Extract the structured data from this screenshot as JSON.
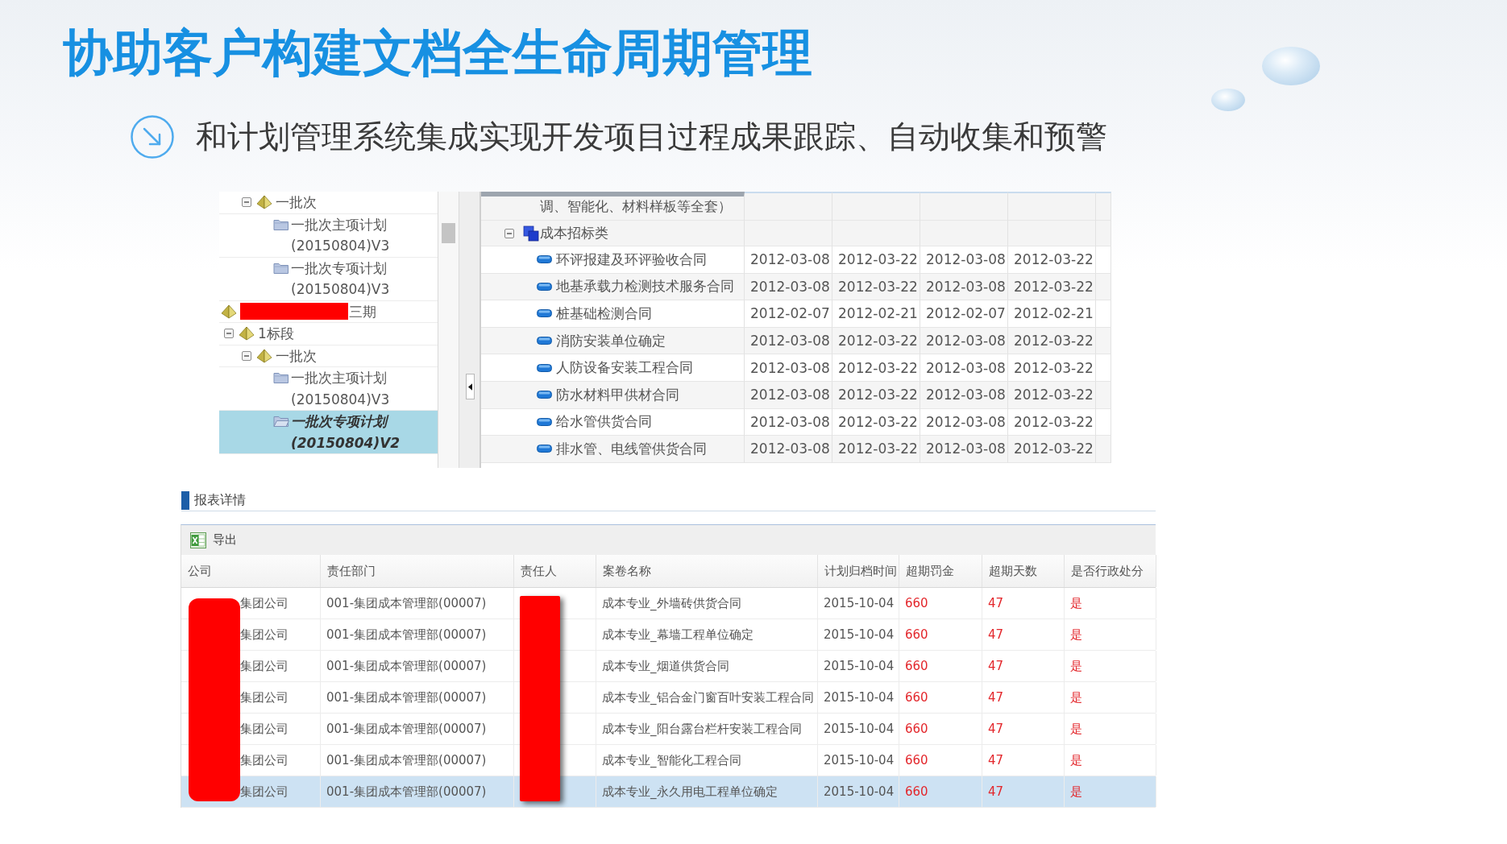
{
  "title": "协助客户构建文档全生命周期管理",
  "subtitle": "和计划管理系统集成实现开发项目过程成果跟踪、自动收集和预警",
  "plan_screen": {
    "tree": [
      {
        "kind": "batch",
        "label": "一批次",
        "expanded": true,
        "selected": false,
        "children": [
          {
            "kind": "plan",
            "label": "一批次主项计划(20150804)V3",
            "selected": false
          },
          {
            "kind": "plan",
            "label": "一批次专项计划(20150804)V3",
            "selected": false
          }
        ]
      },
      {
        "kind": "project",
        "label": "三期",
        "redacted": true,
        "selected": false,
        "children": [
          {
            "kind": "section",
            "label": "1标段",
            "expanded": true,
            "selected": false,
            "children": [
              {
                "kind": "batch",
                "label": "一批次",
                "expanded": true,
                "selected": false,
                "children": [
                  {
                    "kind": "plan",
                    "label": "一批次主项计划(20150804)V3",
                    "selected": false
                  },
                  {
                    "kind": "plan",
                    "label": "一批次专项计划(20150804)V2",
                    "selected": true
                  }
                ]
              }
            ]
          }
        ]
      }
    ],
    "grid": {
      "cut_off_row": {
        "label": "调、智能化、材料样板等全套）"
      },
      "group": {
        "label": "成本招标类",
        "expanded": true
      },
      "rows": [
        {
          "name": "环评报建及环评验收合同",
          "dates": [
            "2012-03-08",
            "2012-03-22",
            "2012-03-08",
            "2012-03-22"
          ]
        },
        {
          "name": "地基承载力检测技术服务合同",
          "dates": [
            "2012-03-08",
            "2012-03-22",
            "2012-03-08",
            "2012-03-22"
          ]
        },
        {
          "name": "桩基础检测合同",
          "dates": [
            "2012-02-07",
            "2012-02-21",
            "2012-02-07",
            "2012-02-21"
          ]
        },
        {
          "name": "消防安装单位确定",
          "dates": [
            "2012-03-08",
            "2012-03-22",
            "2012-03-08",
            "2012-03-22"
          ]
        },
        {
          "name": "人防设备安装工程合同",
          "dates": [
            "2012-03-08",
            "2012-03-22",
            "2012-03-08",
            "2012-03-22"
          ]
        },
        {
          "name": "防水材料甲供材合同",
          "dates": [
            "2012-03-08",
            "2012-03-22",
            "2012-03-08",
            "2012-03-22"
          ]
        },
        {
          "name": "给水管供货合同",
          "dates": [
            "2012-03-08",
            "2012-03-22",
            "2012-03-08",
            "2012-03-22"
          ]
        },
        {
          "name": "排水管、电线管供货合同",
          "dates": [
            "2012-03-08",
            "2012-03-22",
            "2012-03-08",
            "2012-03-22"
          ]
        }
      ]
    }
  },
  "report": {
    "heading": "报表详情",
    "export_button": "导出",
    "columns": [
      {
        "label": "公司",
        "kind": "text",
        "redacted": true
      },
      {
        "label": "责任部门",
        "kind": "text",
        "redacted": false
      },
      {
        "label": "责任人",
        "redacted": true
      },
      {
        "label": "案卷名称",
        "kind": "text",
        "redacted": false
      },
      {
        "label": "计划归档时间",
        "kind": "text",
        "redacted": false
      },
      {
        "label": "超期罚金",
        "kind": "alert",
        "redacted": false
      },
      {
        "label": "超期天数",
        "kind": "alert",
        "redacted": false
      },
      {
        "label": "是否行政处分",
        "kind": "alert",
        "redacted": false
      }
    ],
    "rows": [
      {
        "company": "集团公司",
        "department": "001-集团成本管理部(00007)",
        "file_name": "成本专业_外墙砖供货合同",
        "archive_date": "2015-10-04",
        "fine": "660",
        "overdue_days": "47",
        "administrative_penalty": "是",
        "selected": false
      },
      {
        "company": "集团公司",
        "department": "001-集团成本管理部(00007)",
        "file_name": "成本专业_幕墙工程单位确定",
        "archive_date": "2015-10-04",
        "fine": "660",
        "overdue_days": "47",
        "administrative_penalty": "是",
        "selected": false
      },
      {
        "company": "集团公司",
        "department": "001-集团成本管理部(00007)",
        "file_name": "成本专业_烟道供货合同",
        "archive_date": "2015-10-04",
        "fine": "660",
        "overdue_days": "47",
        "administrative_penalty": "是",
        "selected": false
      },
      {
        "company": "集团公司",
        "department": "001-集团成本管理部(00007)",
        "file_name": "成本专业_铝合金门窗百叶安装工程合同",
        "archive_date": "2015-10-04",
        "fine": "660",
        "overdue_days": "47",
        "administrative_penalty": "是",
        "selected": false
      },
      {
        "company": "集团公司",
        "department": "001-集团成本管理部(00007)",
        "file_name": "成本专业_阳台露台栏杆安装工程合同",
        "archive_date": "2015-10-04",
        "fine": "660",
        "overdue_days": "47",
        "administrative_penalty": "是",
        "selected": false
      },
      {
        "company": "集团公司",
        "department": "001-集团成本管理部(00007)",
        "file_name": "成本专业_智能化工程合同",
        "archive_date": "2015-10-04",
        "fine": "660",
        "overdue_days": "47",
        "administrative_penalty": "是",
        "selected": false
      },
      {
        "company": "集团公司",
        "department": "001-集团成本管理部(00007)",
        "file_name": "成本专业_永久用电工程单位确定",
        "archive_date": "2015-10-04",
        "fine": "660",
        "overdue_days": "47",
        "administrative_penalty": "是",
        "selected": true
      }
    ]
  }
}
